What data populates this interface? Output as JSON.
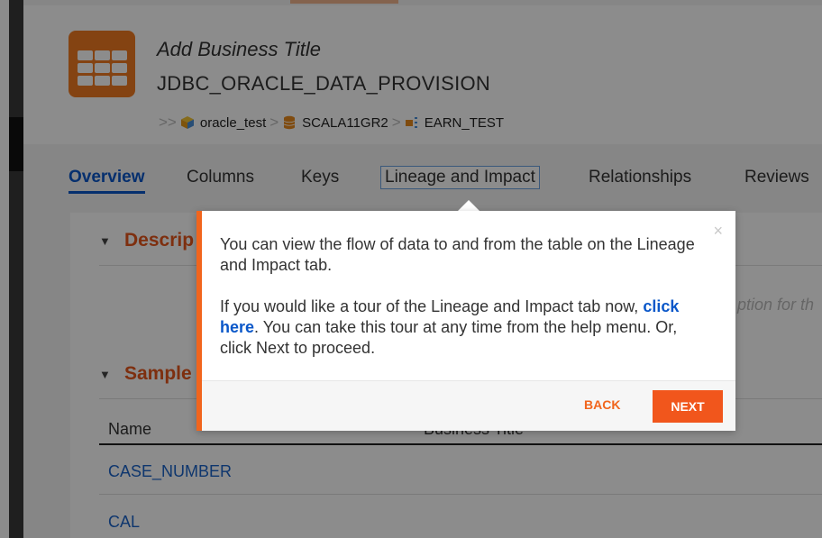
{
  "header": {
    "title": "Add Business Title",
    "subtitle": "JDBC_ORACLE_DATA_PROVISION",
    "breadcrumb": [
      {
        "label": "oracle_test",
        "icon": "cube-icon"
      },
      {
        "label": "SCALA11GR2",
        "icon": "database-icon"
      },
      {
        "label": "EARN_TEST",
        "icon": "schema-icon"
      }
    ]
  },
  "tabs": [
    {
      "label": "Overview",
      "active": true
    },
    {
      "label": "Columns"
    },
    {
      "label": "Keys"
    },
    {
      "label": "Lineage and Impact",
      "focused": true
    },
    {
      "label": "Relationships"
    },
    {
      "label": "Reviews"
    }
  ],
  "sections": {
    "description": {
      "title": "Descrip",
      "placeholder_fragment": "ption for th"
    },
    "sample": {
      "title": "Sample"
    }
  },
  "table": {
    "headers": [
      "Name",
      "Business Title"
    ],
    "rows": [
      "CASE_NUMBER",
      "CAL"
    ]
  },
  "tour": {
    "close": "×",
    "line1": "You can view the flow of data to and from the table on the Lineage and Impact tab.",
    "line2_pre": "If you would like a tour of the Lineage and Impact tab now, ",
    "line2_link": "click here",
    "line2_post": ". You can take this tour at any time from the help menu. Or, click Next to proceed.",
    "back": "BACK",
    "next": "NEXT"
  },
  "colors": {
    "accent": "#f1651d",
    "link": "#0a57c9",
    "section_title": "#e5561c"
  }
}
